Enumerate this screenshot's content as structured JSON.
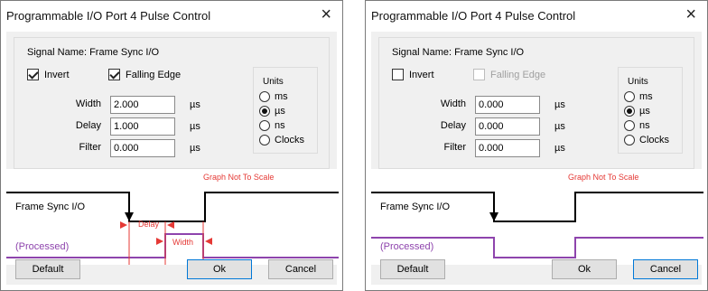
{
  "dialogs": [
    {
      "title": "Programmable I/O Port 4 Pulse Control",
      "close_glyph": "×",
      "signal_name": "Signal Name: Frame Sync I/O",
      "invert": {
        "label": "Invert",
        "checked": true
      },
      "falling_edge": {
        "label": "Falling Edge",
        "checked": true,
        "enabled": true
      },
      "fields": [
        {
          "label": "Width",
          "value": "2.000",
          "unit": "µs"
        },
        {
          "label": "Delay",
          "value": "1.000",
          "unit": "µs"
        },
        {
          "label": "Filter",
          "value": "0.000",
          "unit": "µs"
        }
      ],
      "units": {
        "title": "Units",
        "options": [
          "ms",
          "µs",
          "ns",
          "Clocks"
        ],
        "selected": "µs"
      },
      "graph": {
        "note": "Graph Not To Scale",
        "signal_label": "Frame Sync I/O",
        "processed_label": "(Processed)",
        "delay_label": "Delay",
        "width_label": "Width",
        "colors": {
          "signal": "#000000",
          "processed": "#8e44ad",
          "annotation": "#e53935"
        }
      },
      "buttons": {
        "default": "Default",
        "ok": "Ok",
        "cancel": "Cancel"
      },
      "focused_button": "ok"
    },
    {
      "title": "Programmable I/O Port 4 Pulse Control",
      "close_glyph": "×",
      "signal_name": "Signal Name: Frame Sync I/O",
      "invert": {
        "label": "Invert",
        "checked": false
      },
      "falling_edge": {
        "label": "Falling Edge",
        "checked": false,
        "enabled": false
      },
      "fields": [
        {
          "label": "Width",
          "value": "0.000",
          "unit": "µs"
        },
        {
          "label": "Delay",
          "value": "0.000",
          "unit": "µs"
        },
        {
          "label": "Filter",
          "value": "0.000",
          "unit": "µs"
        }
      ],
      "units": {
        "title": "Units",
        "options": [
          "ms",
          "µs",
          "ns",
          "Clocks"
        ],
        "selected": "µs"
      },
      "graph": {
        "note": "Graph Not To Scale",
        "signal_label": "Frame Sync I/O",
        "processed_label": "(Processed)",
        "colors": {
          "signal": "#000000",
          "processed": "#8e44ad",
          "annotation": "#e53935"
        }
      },
      "buttons": {
        "default": "Default",
        "ok": "Ok",
        "cancel": "Cancel"
      },
      "focused_button": "cancel"
    }
  ]
}
